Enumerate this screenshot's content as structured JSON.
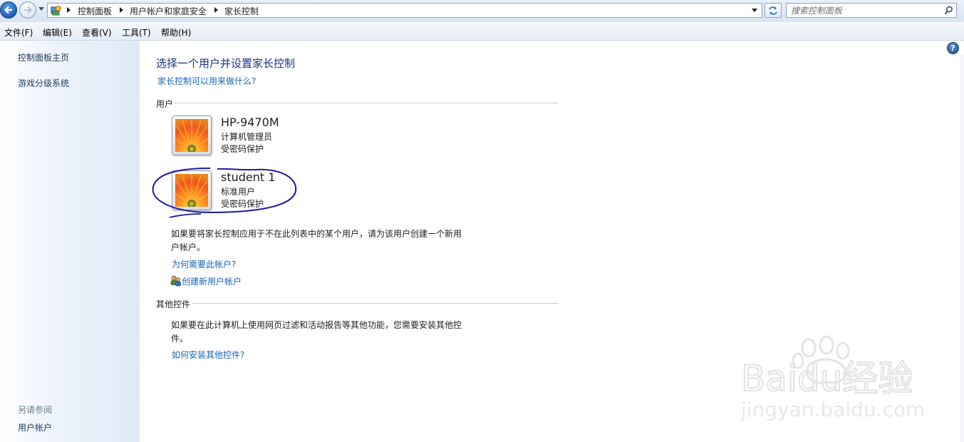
{
  "address_bar": {
    "breadcrumbs": [
      "控制面板",
      "用户帐户和家庭安全",
      "家长控制"
    ],
    "search_placeholder": "搜索控制面板"
  },
  "menu": [
    "文件(F)",
    "编辑(E)",
    "查看(V)",
    "工具(T)",
    "帮助(H)"
  ],
  "sidebar": {
    "items": [
      "控制面板主页",
      "游戏分级系统"
    ],
    "see_also_label": "另请参阅",
    "see_also_items": [
      "用户帐户"
    ]
  },
  "main": {
    "title": "选择一个用户并设置家长控制",
    "help_link": "家长控制可以用来做什么?",
    "users_section": "用户",
    "users": [
      {
        "name": "HP-9470M",
        "role": "计算机管理员",
        "password": "受密码保护"
      },
      {
        "name": "student 1",
        "role": "标准用户",
        "password": "受密码保护"
      }
    ],
    "users_note": "如果要将家长控制应用于不在此列表中的某个用户，请为该用户创建一个新用户帐户。",
    "why_link": "为何需要此帐户?",
    "create_link": "创建新用户帐户",
    "other_section": "其他控件",
    "other_note": "如果要在此计算机上使用网页过滤和活动报告等其他功能，您需要安装其他控件。",
    "install_link": "如何安装其他控件?"
  },
  "watermark": {
    "brand": "Baidu经验",
    "url": "jingyan.baidu.com"
  },
  "colors": {
    "link": "#1666b5",
    "title": "#1e3287",
    "annotation": "#1a1aa8"
  }
}
